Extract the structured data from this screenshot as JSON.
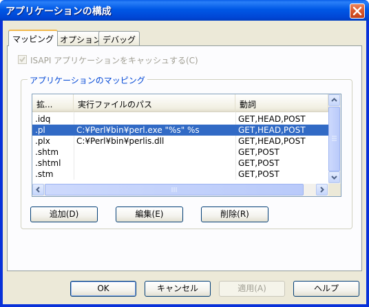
{
  "window": {
    "title": "アプリケーションの構成"
  },
  "tabs": [
    {
      "label": "マッピング"
    },
    {
      "label": "オプション"
    },
    {
      "label": "デバッグ"
    }
  ],
  "cache_checkbox": {
    "label": "ISAPI アプリケーションをキャッシュする(C)",
    "checked": true,
    "enabled": false
  },
  "mapping_group": {
    "title": "アプリケーションのマッピング",
    "columns": [
      "拡...",
      "実行ファイルのパス",
      "動詞"
    ],
    "rows": [
      {
        "ext": ".idq",
        "path": "",
        "verbs": "GET,HEAD,POST"
      },
      {
        "ext": ".pl",
        "path": "C:¥Perl¥bin¥perl.exe \"%s\" %s",
        "verbs": "GET,HEAD,POST",
        "selected": true
      },
      {
        "ext": ".plx",
        "path": "C:¥Perl¥bin¥perlis.dll",
        "verbs": "GET,HEAD,POST"
      },
      {
        "ext": ".shtm",
        "path": "",
        "verbs": "GET,POST"
      },
      {
        "ext": ".shtml",
        "path": "",
        "verbs": "GET,POST"
      },
      {
        "ext": ".stm",
        "path": "",
        "verbs": "GET,POST"
      }
    ]
  },
  "list_buttons": {
    "add": "追加(D)",
    "edit": "編集(E)",
    "delete": "削除(R)"
  },
  "dialog_buttons": {
    "ok": "OK",
    "cancel": "キャンセル",
    "apply": "適用(A)",
    "help": "ヘルプ"
  },
  "colors": {
    "title_bar": "#0058e6",
    "selection": "#316ac5",
    "group_title": "#0046d5"
  }
}
